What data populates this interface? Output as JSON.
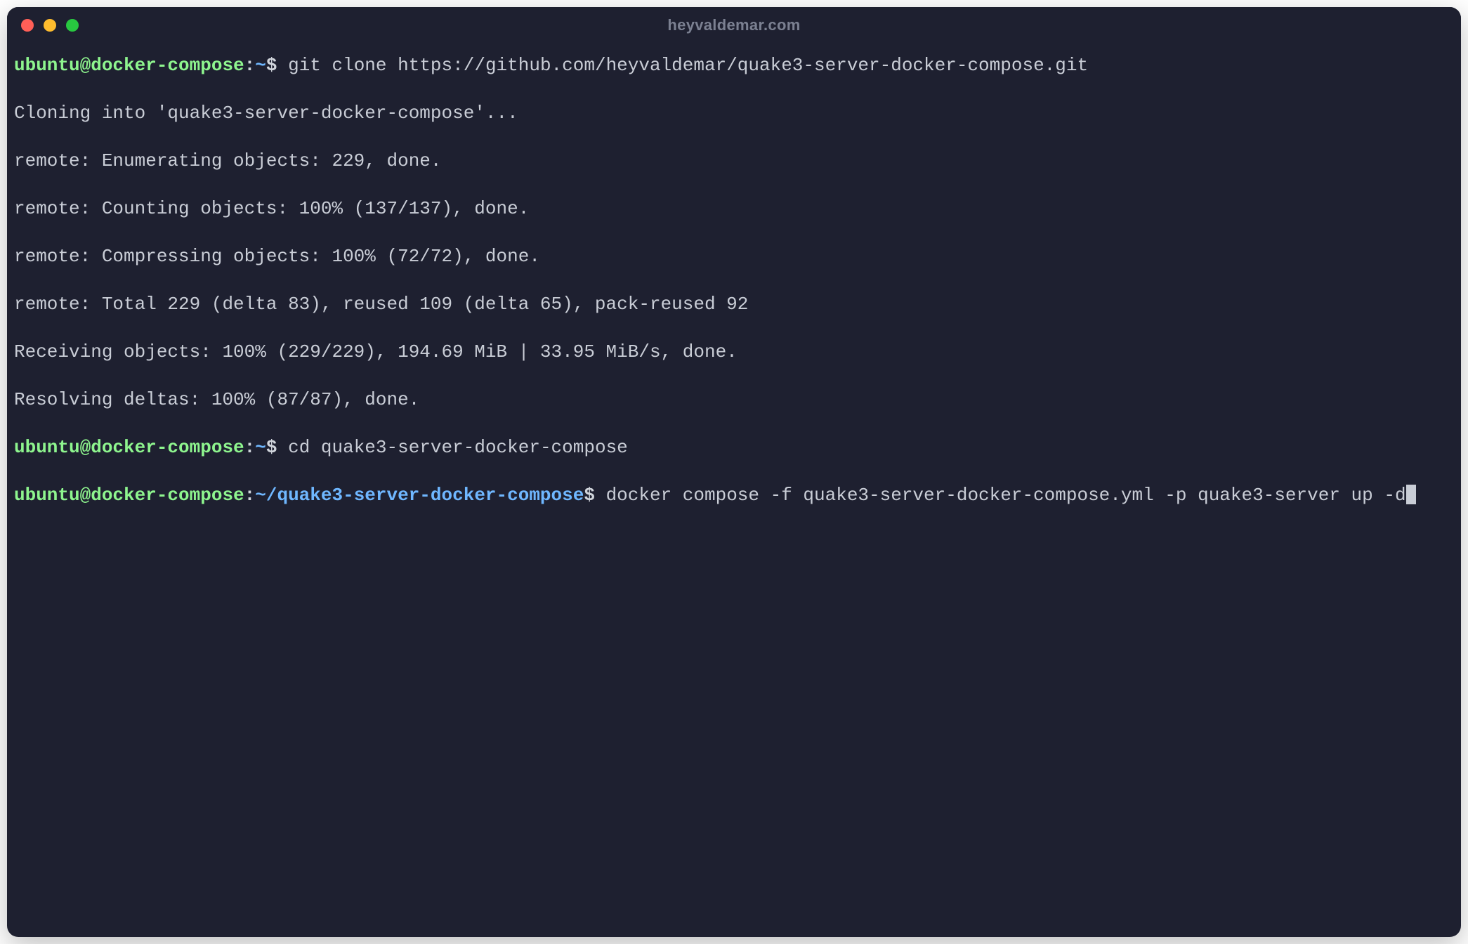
{
  "window": {
    "title": "heyvaldemar.com"
  },
  "prompt1": {
    "user_host": "ubuntu@docker-compose",
    "colon": ":",
    "path": "~",
    "dollar": "$ ",
    "command": "git clone https://github.com/heyvaldemar/quake3-server-docker-compose.git"
  },
  "output": {
    "l1": "Cloning into 'quake3-server-docker-compose'...",
    "l2": "remote: Enumerating objects: 229, done.",
    "l3": "remote: Counting objects: 100% (137/137), done.",
    "l4": "remote: Compressing objects: 100% (72/72), done.",
    "l5": "remote: Total 229 (delta 83), reused 109 (delta 65), pack-reused 92",
    "l6": "Receiving objects: 100% (229/229), 194.69 MiB | 33.95 MiB/s, done.",
    "l7": "Resolving deltas: 100% (87/87), done."
  },
  "prompt2": {
    "user_host": "ubuntu@docker-compose",
    "colon": ":",
    "path": "~",
    "dollar": "$ ",
    "command": "cd quake3-server-docker-compose"
  },
  "prompt3": {
    "user_host": "ubuntu@docker-compose",
    "colon": ":",
    "path": "~/quake3-server-docker-compose",
    "dollar": "$ ",
    "command": "docker compose -f quake3-server-docker-compose.yml -p quake3-server up -d"
  }
}
